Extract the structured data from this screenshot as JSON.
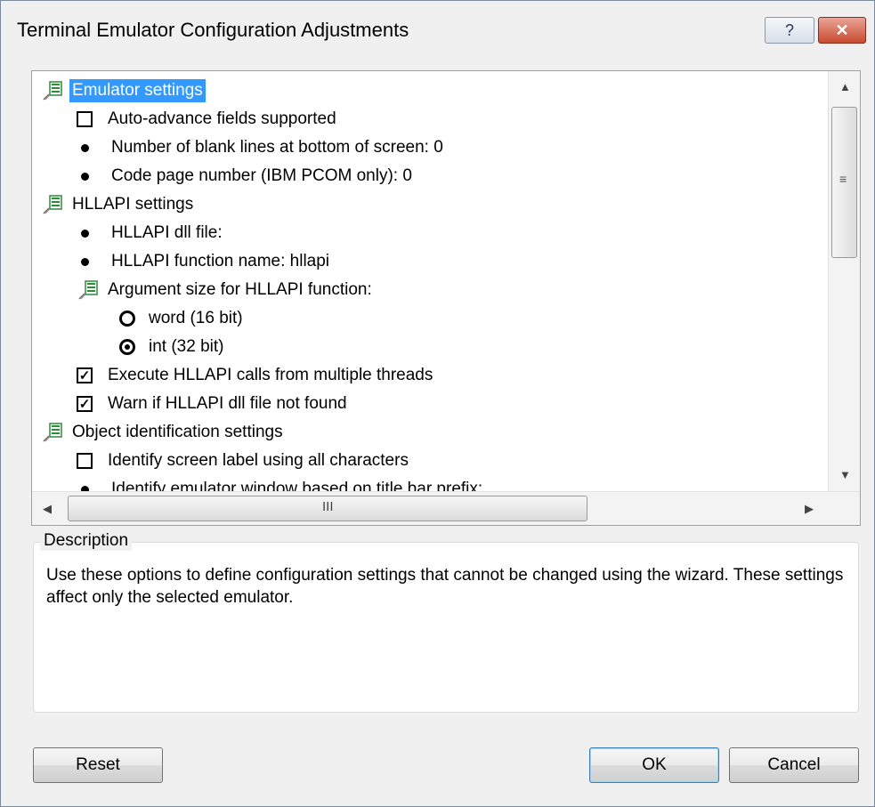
{
  "window": {
    "title": "Terminal Emulator Configuration Adjustments",
    "help_label": "?",
    "close_label": "✕"
  },
  "tree": {
    "items": [
      {
        "type": "category",
        "label": "Emulator settings",
        "selected": true
      },
      {
        "type": "checkbox",
        "label": "Auto-advance fields supported",
        "checked": false
      },
      {
        "type": "value",
        "label": "Number of blank lines at bottom of screen: 0"
      },
      {
        "type": "value",
        "label": "Code page number (IBM PCOM only): 0"
      },
      {
        "type": "category",
        "label": "HLLAPI settings"
      },
      {
        "type": "value",
        "label": "HLLAPI dll file:"
      },
      {
        "type": "value",
        "label": "HLLAPI function name: hllapi"
      },
      {
        "type": "subcategory",
        "label": "Argument size for HLLAPI function:"
      },
      {
        "type": "radio",
        "label": "word (16 bit)",
        "selected": false
      },
      {
        "type": "radio",
        "label": "int (32 bit)",
        "selected": true
      },
      {
        "type": "checkbox",
        "label": "Execute HLLAPI calls from multiple threads",
        "checked": true
      },
      {
        "type": "checkbox",
        "label": "Warn if HLLAPI dll file not found",
        "checked": true
      },
      {
        "type": "category",
        "label": "Object identification settings"
      },
      {
        "type": "checkbox",
        "label": "Identify screen label using all characters",
        "checked": false
      },
      {
        "type": "value",
        "label": "Identify emulator window based on title bar prefix:"
      }
    ]
  },
  "scrollbars": {
    "up": "▲",
    "down": "▼",
    "left": "◀",
    "right": "▶",
    "v_grip": "≡",
    "h_grip": "III"
  },
  "description": {
    "legend": "Description",
    "text": "Use these options to define configuration settings that cannot be changed using the wizard. These settings affect only the selected emulator."
  },
  "buttons": {
    "reset": "Reset",
    "ok": "OK",
    "cancel": "Cancel"
  },
  "colors": {
    "selection": "#3399ff",
    "icon_green": "#2e8b3a"
  }
}
